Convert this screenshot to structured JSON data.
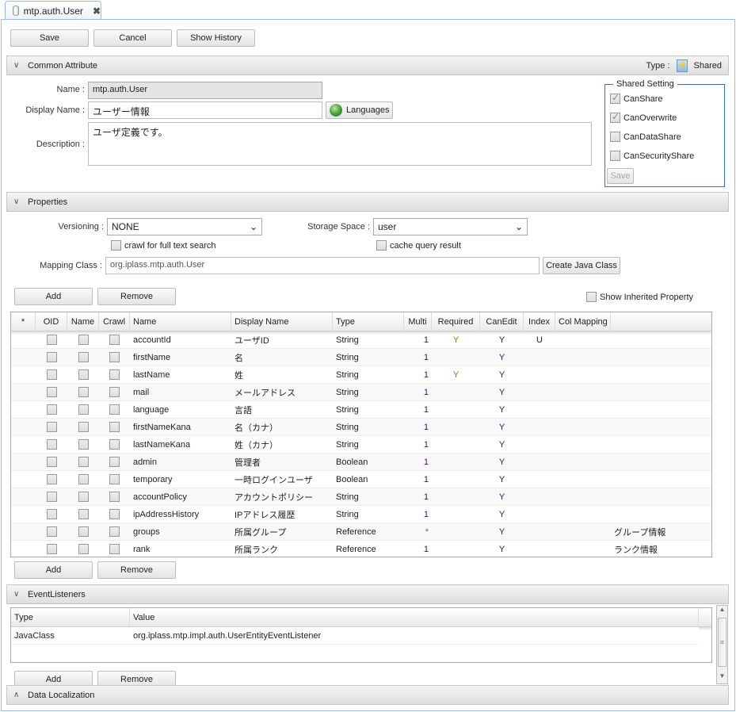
{
  "tab": {
    "title": "mtp.auth.User",
    "icon": "database-icon",
    "close_icon": "close-icon"
  },
  "toolbar": {
    "save": "Save",
    "cancel": "Cancel",
    "history": "Show History"
  },
  "common": {
    "header": "Common Attribute",
    "type_label": "Type :",
    "type_value": "Shared",
    "name_label": "Name :",
    "name_value": "mtp.auth.User",
    "display_label": "Display Name :",
    "display_value": "ユーザー情報",
    "languages": "Languages",
    "desc_label": "Description :",
    "desc_value": "ユーザ定義です。",
    "shared": {
      "legend": "Shared Setting",
      "items": [
        {
          "label": "CanShare",
          "checked": true
        },
        {
          "label": "CanOverwrite",
          "checked": true
        },
        {
          "label": "CanDataShare",
          "checked": false
        },
        {
          "label": "CanSecurityShare",
          "checked": false
        }
      ],
      "save": "Save"
    }
  },
  "properties": {
    "header": "Properties",
    "versioning_label": "Versioning :",
    "versioning_value": "NONE",
    "storage_label": "Storage Space :",
    "storage_value": "user",
    "crawl": "crawl for full text search",
    "cache": "cache query result",
    "mapping_label": "Mapping Class :",
    "mapping_value": "org.iplass.mtp.auth.User",
    "create_java": "Create Java Class",
    "add": "Add",
    "remove": "Remove",
    "show_inherited": "Show Inherited Property",
    "columns": [
      "*",
      "OID",
      "Name",
      "Crawl",
      "Name",
      "Display Name",
      "Type",
      "Multi",
      "Required",
      "CanEdit",
      "Index",
      "Col Mapping",
      ""
    ],
    "rows": [
      [
        "accountId",
        "ユーザID",
        "String",
        "1",
        "Y",
        "Y",
        "U",
        ""
      ],
      [
        "firstName",
        "名",
        "String",
        "1",
        "",
        "Y",
        "",
        ""
      ],
      [
        "lastName",
        "姓",
        "String",
        "1",
        "Y",
        "Y",
        "",
        ""
      ],
      [
        "mail",
        "メールアドレス",
        "String",
        "1",
        "",
        "Y",
        "",
        ""
      ],
      [
        "language",
        "言語",
        "String",
        "1",
        "",
        "Y",
        "",
        ""
      ],
      [
        "firstNameKana",
        "名（カナ）",
        "String",
        "1",
        "",
        "Y",
        "",
        ""
      ],
      [
        "lastNameKana",
        "姓（カナ）",
        "String",
        "1",
        "",
        "Y",
        "",
        ""
      ],
      [
        "admin",
        "管理者",
        "Boolean",
        "1",
        "",
        "Y",
        "",
        ""
      ],
      [
        "temporary",
        "一時ログインユーザ",
        "Boolean",
        "1",
        "",
        "Y",
        "",
        ""
      ],
      [
        "accountPolicy",
        "アカウントポリシー",
        "String",
        "1",
        "",
        "Y",
        "",
        ""
      ],
      [
        "ipAddressHistory",
        "IPアドレス履歴",
        "String",
        "1",
        "",
        "Y",
        "",
        ""
      ],
      [
        "groups",
        "所属グループ",
        "Reference",
        "*",
        "",
        "Y",
        "",
        "グループ情報"
      ],
      [
        "rank",
        "所属ランク",
        "Reference",
        "1",
        "",
        "Y",
        "",
        "ランク情報"
      ]
    ]
  },
  "events": {
    "header": "EventListeners",
    "columns": [
      "Type",
      "Value"
    ],
    "rows": [
      [
        "JavaClass",
        "org.iplass.mtp.impl.auth.UserEntityEventListener"
      ]
    ],
    "add": "Add",
    "remove": "Remove"
  },
  "localization": {
    "header": "Data Localization"
  }
}
